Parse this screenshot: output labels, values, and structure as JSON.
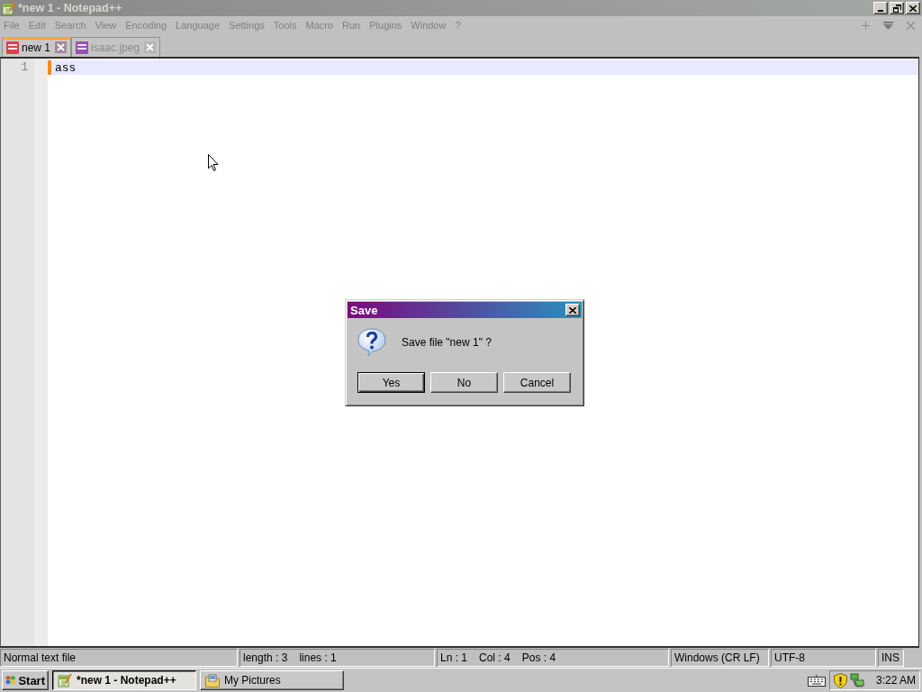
{
  "window": {
    "title": "*new 1 - Notepad++"
  },
  "menu": [
    {
      "label": "File",
      "disabled": true
    },
    {
      "label": "Edit",
      "disabled": true
    },
    {
      "label": "Search",
      "disabled": true
    },
    {
      "label": "View",
      "disabled": true
    },
    {
      "label": "Encoding",
      "disabled": true
    },
    {
      "label": "Language",
      "disabled": true
    },
    {
      "label": "Settings",
      "disabled": true
    },
    {
      "label": "Tools",
      "disabled": true
    },
    {
      "label": "Macro",
      "disabled": true
    },
    {
      "label": "Run",
      "disabled": true
    },
    {
      "label": "Plugins",
      "disabled": true
    },
    {
      "label": "Window",
      "disabled": true
    },
    {
      "label": "?",
      "disabled": true
    }
  ],
  "tabs": [
    {
      "label": "new 1",
      "selected": true,
      "color": "#e0404c"
    },
    {
      "label": "isaac.jpeg",
      "selected": false,
      "color": "#9a50b0"
    }
  ],
  "editor": {
    "lines": [
      {
        "number": "1",
        "text": "ass",
        "current": true,
        "changed": true
      }
    ]
  },
  "dialog": {
    "title": "Save",
    "message": "Save file \"new 1\" ?",
    "buttons": [
      {
        "label": "Yes",
        "default": true
      },
      {
        "label": "No",
        "default": false
      },
      {
        "label": "Cancel",
        "default": false
      }
    ]
  },
  "status_bar": [
    {
      "items": [
        "Normal text file"
      ]
    },
    {
      "items": [
        "length : 3",
        "lines : 1"
      ]
    },
    {
      "items": [
        "Ln : 1",
        "Col : 4",
        "Pos : 4"
      ]
    },
    {
      "items": [
        "Windows (CR LF)"
      ]
    },
    {
      "items": [
        "UTF-8"
      ]
    },
    {
      "items": [
        "INS"
      ]
    }
  ],
  "taskbar": {
    "start": "Start",
    "tasks": [
      {
        "label": "*new 1 - Notepad++",
        "selected": true,
        "kind": "notepad"
      },
      {
        "label": "My Pictures",
        "selected": false,
        "kind": "folder"
      }
    ],
    "clock": "3:22 AM"
  }
}
